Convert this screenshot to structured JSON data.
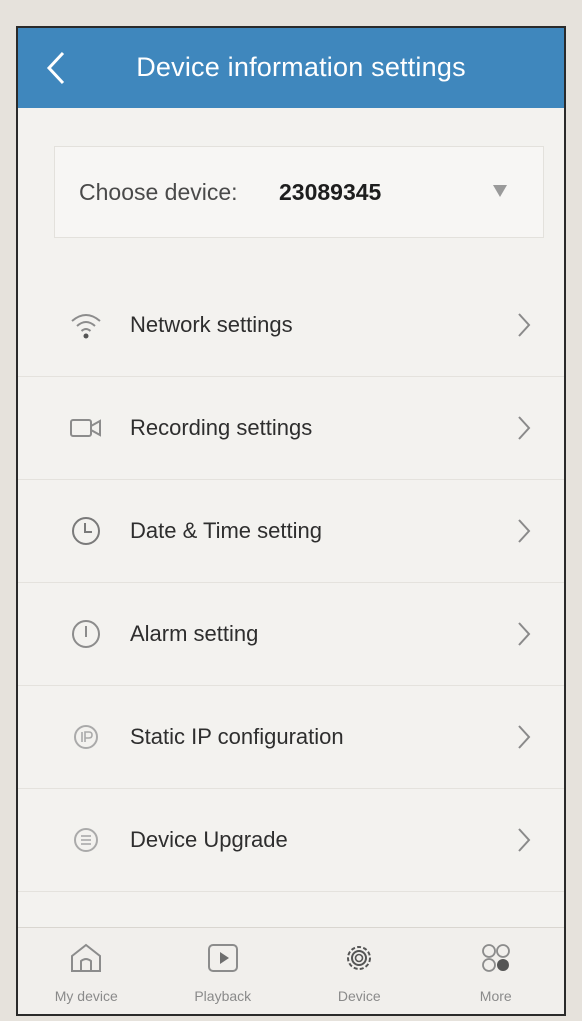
{
  "header": {
    "title": "Device information settings",
    "back_icon": "chevron-left-icon"
  },
  "device_picker": {
    "label": "Choose device:",
    "value": "23089345"
  },
  "menu": [
    {
      "label": "Network settings",
      "icon": "wifi-icon"
    },
    {
      "label": "Recording settings",
      "icon": "video-camera-icon"
    },
    {
      "label": "Date & Time setting",
      "icon": "clock-icon"
    },
    {
      "label": "Alarm setting",
      "icon": "alert-icon"
    },
    {
      "label": "Static IP configuration",
      "icon": "ip-icon"
    },
    {
      "label": "Device Upgrade",
      "icon": "upgrade-icon"
    }
  ],
  "tabs": [
    {
      "label": "My device",
      "icon": "home-icon"
    },
    {
      "label": "Playback",
      "icon": "playback-icon"
    },
    {
      "label": "Device",
      "icon": "gear-icon",
      "active": true
    },
    {
      "label": "More",
      "icon": "more-icon"
    }
  ],
  "colors": {
    "header_bg": "#3f87bd",
    "icon_gray": "#8c8c8c",
    "text": "#2e2e2e"
  }
}
